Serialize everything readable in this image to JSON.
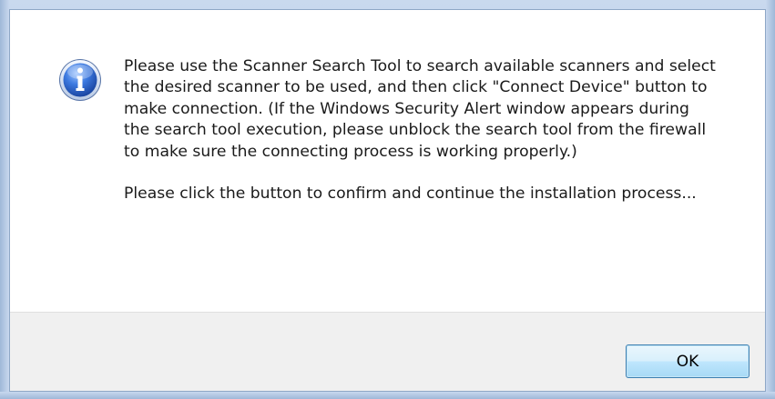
{
  "dialog": {
    "icon": "information-icon",
    "message_paragraph_1": "Please use the Scanner Search Tool to search available scanners and select the desired scanner to be used, and then click \"Connect Device\" button to make connection. (If the Windows Security Alert window appears during the search tool execution, please unblock the search tool from the firewall to make sure the connecting process is working properly.)",
    "message_paragraph_2": "Please click the button to confirm and continue the installation process...",
    "ok_label": "OK"
  },
  "colors": {
    "frame": "#b9cde7",
    "footer": "#f0f0f0",
    "button_border": "#3c7fb1",
    "icon_blue": "#2a63c4"
  }
}
